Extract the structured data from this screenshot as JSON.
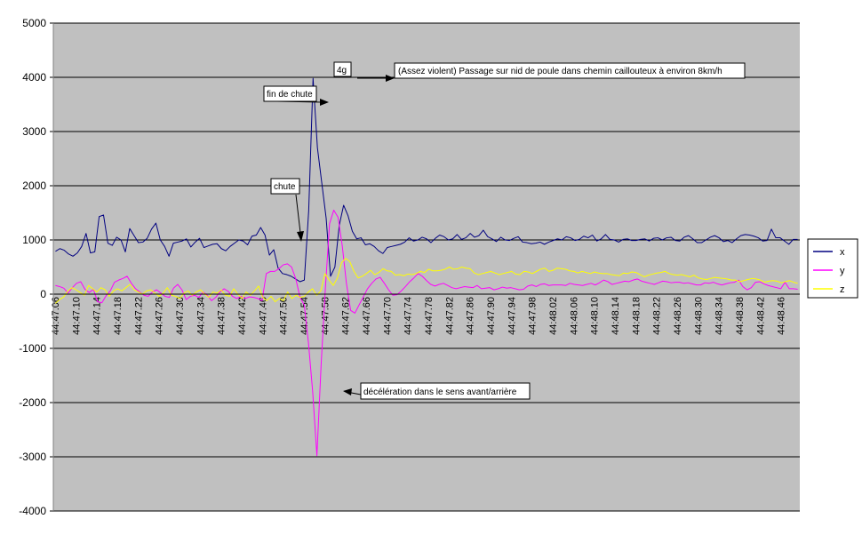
{
  "chart_data": {
    "type": "line",
    "title": "",
    "xlabel": "",
    "ylabel": "",
    "ylim": [
      -4000,
      5000
    ],
    "y_ticks": [
      5000,
      4000,
      3000,
      2000,
      1000,
      0,
      -1000,
      -2000,
      -3000,
      -4000
    ],
    "grid": "horizontal",
    "plot_background": "#c0c0c0",
    "legend_position": "right",
    "x_tick_labels": [
      "44:47.06",
      "44:47.10",
      "44:47.14",
      "44:47.18",
      "44:47.22",
      "44:47.26",
      "44:47.30",
      "44:47.34",
      "44:47.38",
      "44:47.42",
      "44:47.46",
      "44:47.50",
      "44:47.54",
      "44:47.58",
      "44:47.62",
      "44:47.66",
      "44:47.70",
      "44:47.74",
      "44:47.78",
      "44:47.82",
      "44:47.86",
      "44:47.90",
      "44:47.94",
      "44:47.98",
      "44:48.02",
      "44:48.06",
      "44:48.10",
      "44:48.14",
      "44:48.18",
      "44:48.22",
      "44:48.26",
      "44:48.30",
      "44:48.34",
      "44:48.38",
      "44:48.42",
      "44:48.46"
    ],
    "series": [
      {
        "name": "x",
        "color": "#000080",
        "values": [
          790,
          840,
          810,
          740,
          700,
          760,
          880,
          1120,
          760,
          780,
          1430,
          1460,
          940,
          900,
          1050,
          1000,
          780,
          1210,
          1080,
          950,
          960,
          1030,
          1200,
          1310,
          1000,
          880,
          700,
          940,
          960,
          980,
          1020,
          870,
          960,
          1030,
          860,
          890,
          920,
          930,
          840,
          800,
          880,
          940,
          1000,
          980,
          910,
          1070,
          1090,
          1230,
          1090,
          720,
          820,
          480,
          380,
          360,
          330,
          280,
          230,
          260,
          1540,
          3980,
          2700,
          2050,
          1400,
          330,
          500,
          1270,
          1640,
          1450,
          1160,
          1020,
          1040,
          910,
          930,
          880,
          800,
          750,
          860,
          880,
          900,
          920,
          960,
          1040,
          980,
          1000,
          1050,
          1020,
          950,
          1030,
          1090,
          1060,
          1000,
          1020,
          1100,
          1010,
          1040,
          1120,
          1050,
          1080,
          1180,
          1060,
          1020,
          970,
          1050,
          1000,
          990,
          1030,
          1060,
          960,
          950,
          930,
          940,
          960,
          920,
          960,
          990,
          1020,
          1000,
          1060,
          1040,
          990,
          1010,
          1070,
          1040,
          1090,
          980,
          1020,
          1100,
          1010,
          1000,
          960,
          1010,
          1020,
          990,
          990,
          1010,
          1020,
          980,
          1030,
          1040,
          1000,
          1040,
          1050,
          990,
          980,
          1050,
          1080,
          1020,
          950,
          950,
          1000,
          1050,
          1080,
          1040,
          970,
          990,
          950,
          1020,
          1080,
          1100,
          1090,
          1070,
          1040,
          980,
          990,
          1200,
          1040,
          1040,
          980,
          920,
          1010,
          1010
        ]
      },
      {
        "name": "y",
        "color": "#ff00ff",
        "values": [
          160,
          140,
          110,
          20,
          120,
          200,
          230,
          90,
          30,
          90,
          -140,
          -160,
          -30,
          60,
          220,
          260,
          290,
          330,
          200,
          100,
          40,
          -20,
          -40,
          40,
          80,
          20,
          -40,
          -60,
          110,
          180,
          80,
          -100,
          -40,
          -20,
          -60,
          40,
          -20,
          -120,
          -60,
          40,
          100,
          50,
          -40,
          -80,
          -40,
          -80,
          -50,
          -60,
          -80,
          -120,
          380,
          420,
          420,
          470,
          540,
          560,
          500,
          280,
          -60,
          -200,
          -900,
          -1800,
          -2980,
          -1300,
          100,
          1300,
          1550,
          1420,
          900,
          200,
          -300,
          -350,
          -200,
          -50,
          100,
          200,
          280,
          310,
          200,
          80,
          -20,
          -10,
          60,
          140,
          230,
          300,
          380,
          330,
          250,
          180,
          150,
          180,
          200,
          160,
          120,
          100,
          120,
          140,
          130,
          120,
          160,
          100,
          110,
          120,
          80,
          100,
          130,
          110,
          120,
          100,
          80,
          90,
          150,
          170,
          140,
          180,
          190,
          160,
          170,
          170,
          170,
          160,
          200,
          180,
          170,
          160,
          180,
          200,
          170,
          210,
          260,
          230,
          180,
          200,
          220,
          240,
          230,
          260,
          280,
          240,
          220,
          200,
          180,
          210,
          240,
          230,
          210,
          220,
          220,
          200,
          210,
          190,
          170,
          170,
          210,
          200,
          220,
          190,
          170,
          190,
          210,
          220,
          260,
          140,
          80,
          120,
          220,
          230,
          190,
          160,
          140,
          120,
          100,
          220,
          100,
          100,
          90
        ]
      },
      {
        "name": "z",
        "color": "#ffff00",
        "values": [
          -170,
          -100,
          -50,
          60,
          120,
          80,
          30,
          -20,
          160,
          100,
          40,
          120,
          80,
          -40,
          60,
          100,
          60,
          120,
          180,
          80,
          40,
          0,
          60,
          80,
          20,
          -40,
          20,
          120,
          -20,
          -40,
          -80,
          20,
          60,
          -20,
          40,
          80,
          0,
          -60,
          40,
          20,
          80,
          -20,
          -40,
          100,
          0,
          -80,
          40,
          -20,
          60,
          150,
          -60,
          -120,
          -40,
          -140,
          -80,
          -120,
          40,
          -80,
          -20,
          -60,
          -40,
          40,
          100,
          -20,
          60,
          380,
          260,
          160,
          300,
          580,
          660,
          600,
          420,
          300,
          330,
          380,
          440,
          360,
          400,
          470,
          430,
          420,
          350,
          360,
          340,
          370,
          360,
          380,
          420,
          400,
          460,
          430,
          430,
          440,
          460,
          500,
          460,
          470,
          500,
          480,
          470,
          390,
          360,
          380,
          400,
          420,
          390,
          360,
          380,
          400,
          420,
          370,
          360,
          420,
          410,
          380,
          420,
          460,
          480,
          420,
          440,
          480,
          470,
          460,
          430,
          420,
          390,
          420,
          400,
          380,
          410,
          390,
          380,
          380,
          360,
          350,
          340,
          390,
          380,
          410,
          400,
          360,
          320,
          350,
          370,
          390,
          400,
          420,
          380,
          360,
          350,
          360,
          340,
          320,
          350,
          300,
          280,
          270,
          290,
          310,
          300,
          290,
          280,
          260,
          260,
          230,
          250,
          270,
          290,
          280,
          260,
          220,
          240,
          250,
          240,
          210,
          230,
          250,
          220,
          200
        ]
      }
    ],
    "annotations": [
      {
        "text": "(Assez violent) Passage sur nid de poule dans chemin caillouteux à environ 8km/h"
      },
      {
        "text": "4g"
      },
      {
        "text": "fin de chute"
      },
      {
        "text": "chute"
      },
      {
        "text": "décélération dans le sens avant/arrière"
      }
    ]
  }
}
